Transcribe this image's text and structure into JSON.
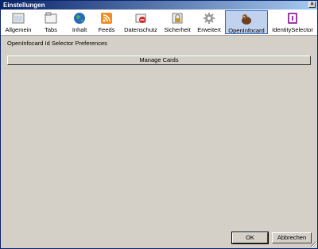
{
  "window": {
    "title": "Einstellungen"
  },
  "tabs": [
    {
      "label": "Allgemein",
      "icon": "general-icon"
    },
    {
      "label": "Tabs",
      "icon": "tabs-icon"
    },
    {
      "label": "Inhalt",
      "icon": "globe-icon"
    },
    {
      "label": "Feeds",
      "icon": "rss-icon"
    },
    {
      "label": "Datenschutz",
      "icon": "privacy-icon"
    },
    {
      "label": "Sicherheit",
      "icon": "lock-icon"
    },
    {
      "label": "Erweitert",
      "icon": "gear-icon"
    },
    {
      "label": "OpenInfocard",
      "icon": "openinfocard-icon",
      "selected": true
    },
    {
      "label": "IdentitySelector",
      "icon": "identity-selector-icon"
    }
  ],
  "panel": {
    "title": "OpenInfocard Id Selector Preferences",
    "manage_label": "Manage Cards"
  },
  "footer": {
    "ok_label": "OK",
    "cancel_label": "Abbrechen"
  }
}
